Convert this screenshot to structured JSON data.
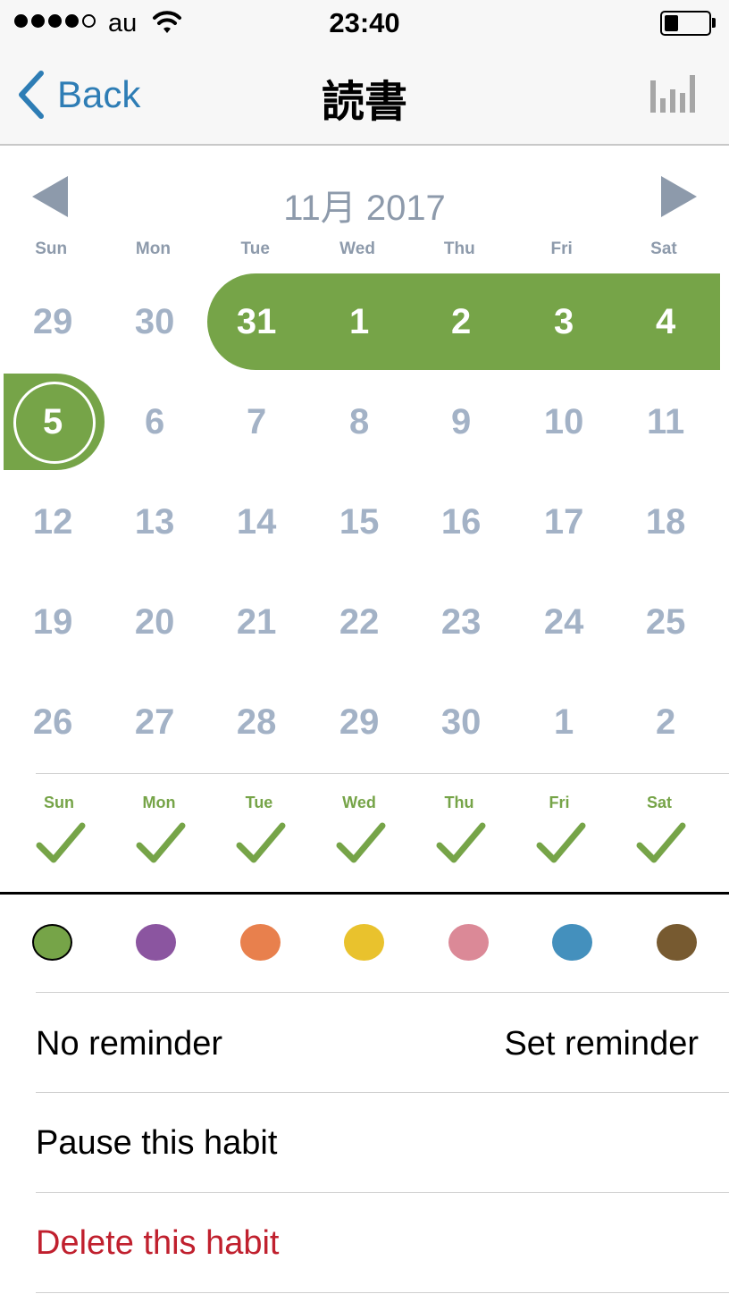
{
  "status_bar": {
    "carrier": "au",
    "time": "23:40",
    "battery_level": 0.3
  },
  "nav": {
    "back_label": "Back",
    "title": "読書",
    "back_icon": "chevron-left-icon",
    "stats_icon": "bar-chart-icon"
  },
  "calendar": {
    "month_title": "11月 2017",
    "weekdays": [
      "Sun",
      "Mon",
      "Tue",
      "Wed",
      "Thu",
      "Fri",
      "Sat"
    ],
    "weeks": [
      [
        "29",
        "30",
        "31",
        "1",
        "2",
        "3",
        "4"
      ],
      [
        "5",
        "6",
        "7",
        "8",
        "9",
        "10",
        "11"
      ],
      [
        "12",
        "13",
        "14",
        "15",
        "16",
        "17",
        "18"
      ],
      [
        "19",
        "20",
        "21",
        "22",
        "23",
        "24",
        "25"
      ],
      [
        "26",
        "27",
        "28",
        "29",
        "30",
        "1",
        "2"
      ]
    ],
    "completed_days": [
      "10/31",
      "11/1",
      "11/2",
      "11/3",
      "11/4",
      "11/5"
    ],
    "today": "11/5"
  },
  "week_checks": {
    "days": [
      "Sun",
      "Mon",
      "Tue",
      "Wed",
      "Thu",
      "Fri",
      "Sat"
    ],
    "icon": "checkmark-icon"
  },
  "colors": {
    "options": [
      "#76a448",
      "#8b55a0",
      "#e8804d",
      "#e9c22d",
      "#db8997",
      "#4490bd",
      "#775a30"
    ],
    "selected": "#76a448"
  },
  "settings": {
    "no_reminder": "No reminder",
    "set_reminder": "Set reminder",
    "pause": "Pause this habit",
    "delete": "Delete this habit"
  },
  "theme": {
    "accent": "#76a448",
    "link": "#2e7db5",
    "muted": "#a3b2c6",
    "danger": "#c0202e"
  }
}
